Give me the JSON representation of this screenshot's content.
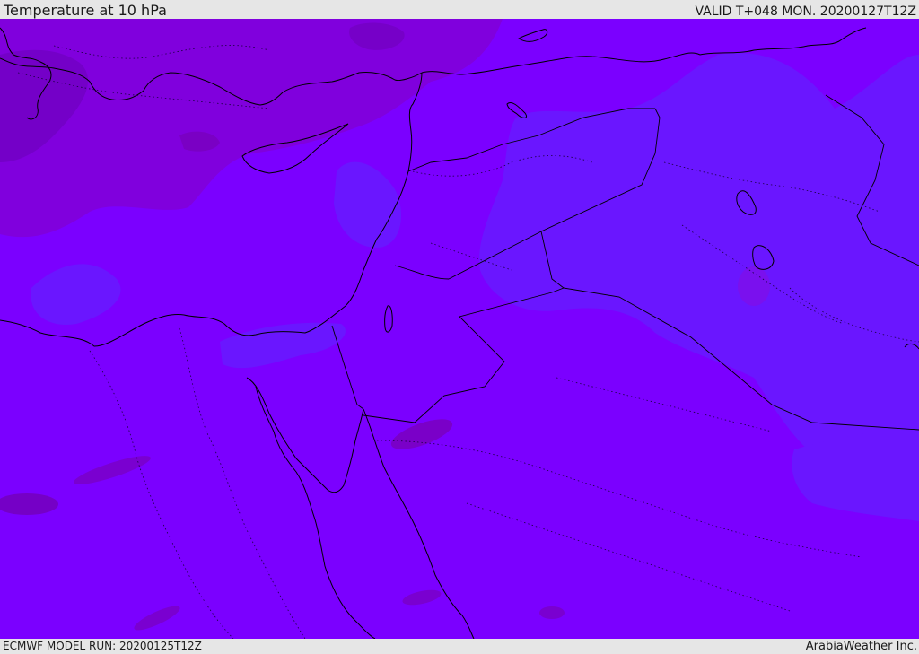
{
  "header": {
    "title": "Temperature at 10 hPa",
    "valid_time": "VALID T+048 MON. 20200127T12Z"
  },
  "footer": {
    "model_run": "ECMWF MODEL RUN: 20200125T12Z",
    "credit": "ArabiaWeather Inc."
  },
  "map": {
    "colors": {
      "base": "#7b00ff",
      "warm_zone": "#8000dd",
      "warm_core": "#7400c8",
      "cold_zone": "#6a16ff",
      "coastline": "#000000"
    }
  }
}
